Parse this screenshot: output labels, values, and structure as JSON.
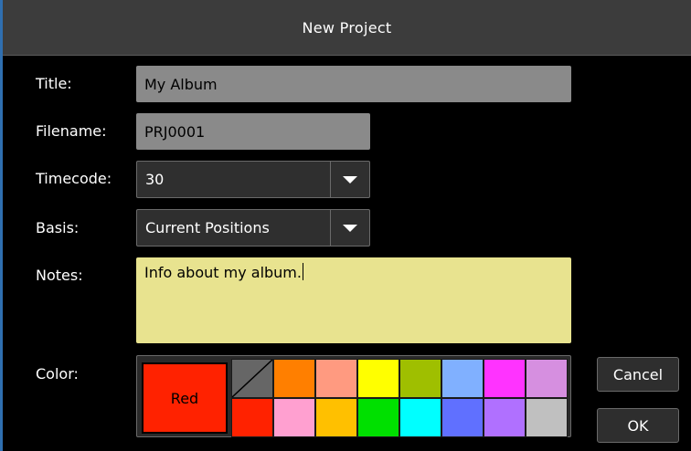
{
  "dialog": {
    "title": "New Project"
  },
  "form": {
    "title_label": "Title:",
    "title_value": "My Album",
    "filename_label": "Filename:",
    "filename_value": "PRJ0001",
    "timecode_label": "Timecode:",
    "timecode_value": "30",
    "basis_label": "Basis:",
    "basis_value": "Current Positions",
    "notes_label": "Notes:",
    "notes_value": "Info about my album.",
    "color_label": "Color:"
  },
  "color_picker": {
    "selected_label": "Red",
    "selected_color": "#ff2200",
    "top_row": [
      "none",
      "#ff7f00",
      "#ff9a80",
      "#ffff00",
      "#9fbf00",
      "#80b0ff",
      "#ff33ff",
      "#d68fe0"
    ],
    "bottom_row": [
      "#ff2200",
      "#ffa0d0",
      "#ffc000",
      "#00e000",
      "#00ffff",
      "#6070ff",
      "#b070ff",
      "#c0c0c0"
    ]
  },
  "buttons": {
    "cancel_label": "Cancel",
    "ok_label": "OK"
  },
  "icons": {
    "dropdown": "chevron-down-icon",
    "no_color": "no-color-slash-icon"
  }
}
